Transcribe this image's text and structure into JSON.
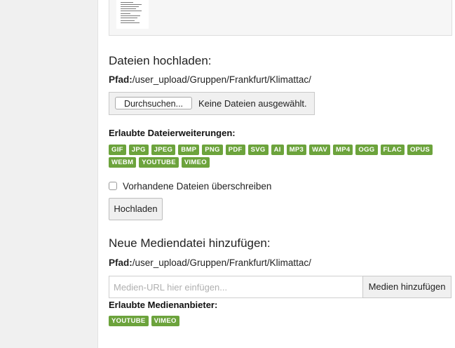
{
  "upload": {
    "heading": "Dateien hochladen:",
    "path_label": "Pfad:",
    "path_value": "/user_upload/Gruppen/Frankfurt/Klimattac/",
    "browse_label": "Durchsuchen...",
    "no_file_text": "Keine Dateien ausgewählt.",
    "extensions_label": "Erlaubte Dateierweiterungen:",
    "extensions": [
      "GIF",
      "JPG",
      "JPEG",
      "BMP",
      "PNG",
      "PDF",
      "SVG",
      "AI",
      "MP3",
      "WAV",
      "MP4",
      "OGG",
      "FLAC",
      "OPUS",
      "WEBM",
      "YOUTUBE",
      "VIMEO"
    ],
    "overwrite_label": "Vorhandene Dateien überschreiben",
    "overwrite_checked": false,
    "submit_label": "Hochladen"
  },
  "media": {
    "heading": "Neue Mediendatei hinzufügen:",
    "path_label": "Pfad:",
    "path_value": "/user_upload/Gruppen/Frankfurt/Klimattac/",
    "url_placeholder": "Medien-URL hier einfügen...",
    "add_label": "Medien hinzufügen",
    "providers_label": "Erlaubte Medienanbieter:",
    "providers": [
      "YOUTUBE",
      "VIMEO"
    ]
  },
  "colors": {
    "tag_green": "#6ca33c",
    "sidebar_bg": "#f0f0f0"
  }
}
